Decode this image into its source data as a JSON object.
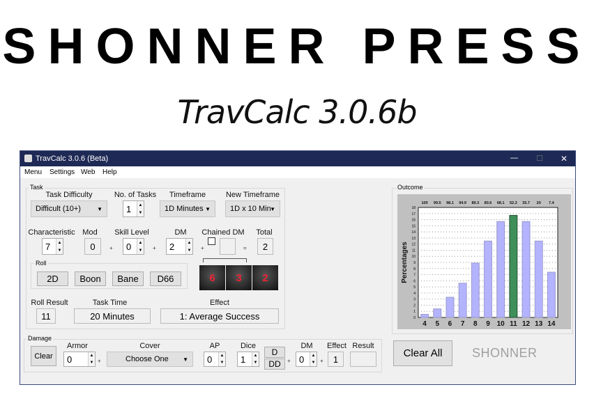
{
  "header": {
    "brand": "SHONNER PRESS",
    "subtitle": "TravCalc 3.0.6b"
  },
  "window": {
    "title": "TravCalc 3.0.6 (Beta)",
    "controls": {
      "minimize": "—",
      "maximize": "☐",
      "close": "✕"
    }
  },
  "menu": [
    "Menu",
    "Settings",
    "Web",
    "Help"
  ],
  "task": {
    "group": "Task",
    "difficulty_label": "Task Difficulty",
    "difficulty": "Difficult (10+)",
    "num_tasks_label": "No. of Tasks",
    "num_tasks": "1",
    "timeframe_label": "Timeframe",
    "timeframe": "1D Minutes",
    "new_timeframe_label": "New Timeframe",
    "new_timeframe": "1D x 10 Min",
    "characteristic_label": "Characteristic",
    "characteristic": "7",
    "mod_label": "Mod",
    "mod": "0",
    "skill_label": "Skill Level",
    "skill": "0",
    "dm_label": "DM",
    "dm": "2",
    "chained_label": "Chained DM",
    "chained": "",
    "total_label": "Total",
    "total": "2",
    "plus": "+",
    "equals": "=",
    "roll_group": "Roll",
    "roll_buttons": [
      "2D",
      "Boon",
      "Bane",
      "D66"
    ],
    "dice": [
      "6",
      "3",
      "2"
    ],
    "roll_result_label": "Roll Result",
    "roll_result": "11",
    "task_time_label": "Task Time",
    "task_time": "20 Minutes",
    "effect_label": "Effect",
    "effect": "1: Average Success"
  },
  "damage": {
    "group": "Damage",
    "clear": "Clear",
    "armor_label": "Armor",
    "armor": "0",
    "cover_label": "Cover",
    "cover": "Choose One",
    "ap_label": "AP",
    "ap": "0",
    "dice_label": "Dice",
    "dice": "1",
    "d_button": "D",
    "dd_button": "DD",
    "dm_label": "DM",
    "dm": "0",
    "effect_label": "Effect",
    "effect": "1",
    "result_label": "Result",
    "result": ""
  },
  "clear_all": "Clear All",
  "logo": "SHONNER",
  "outcome": {
    "group": "Outcome"
  },
  "chart_data": {
    "type": "bar",
    "ylabel": "Percentages",
    "categories": [
      "4",
      "5",
      "6",
      "7",
      "8",
      "9",
      "10",
      "11",
      "12",
      "13",
      "14"
    ],
    "values": [
      0.5,
      1.4,
      3.3,
      5.6,
      8.9,
      12.5,
      15.7,
      16.7,
      15.7,
      12.5,
      7.4
    ],
    "top_labels": [
      "100",
      "99.5",
      "98.1",
      "94.9",
      "89.3",
      "80.6",
      "68.1",
      "52.3",
      "35.7",
      "20",
      "7.4"
    ],
    "highlight": "11",
    "ylim": [
      0,
      18
    ],
    "yticks": [
      "0",
      "1",
      "2",
      "3",
      "4",
      "5",
      "6",
      "7",
      "8",
      "9",
      "10",
      "11",
      "12",
      "13",
      "14",
      "15",
      "16",
      "17",
      "18"
    ],
    "grid": true,
    "colors": {
      "bar": "#b3b3ff",
      "highlight": "#3f8f5a",
      "panel": "#c0c0c0"
    }
  }
}
